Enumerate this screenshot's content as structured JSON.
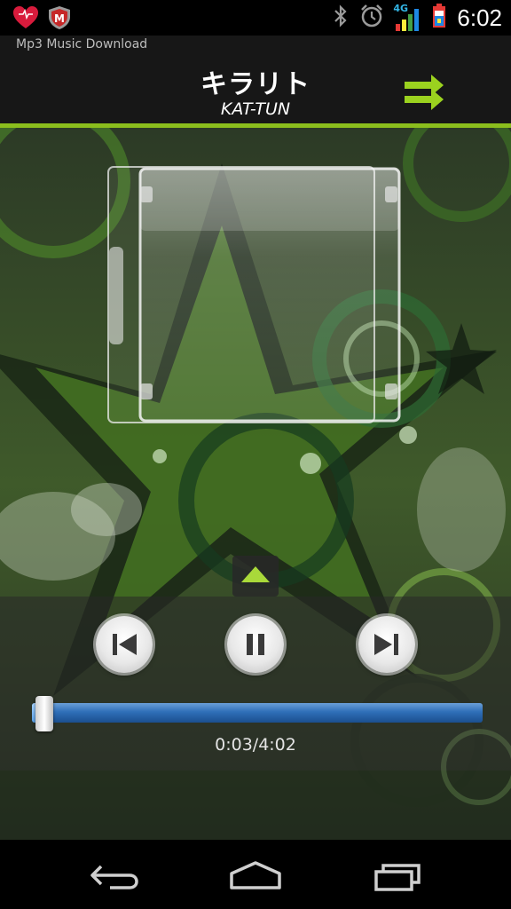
{
  "status_bar": {
    "time": "6:02",
    "icons": [
      "heart-app-icon",
      "mcafee-icon",
      "bluetooth-icon",
      "alarm-icon",
      "signal-4g-icon",
      "battery-icon"
    ],
    "network_label": "4G"
  },
  "app": {
    "name": "Mp3 Music Download"
  },
  "now_playing": {
    "title": "キラリト",
    "artist": "KAT-TUN"
  },
  "playback": {
    "time_display": "0:03/4:02",
    "progress": 0.0124
  },
  "controls": [
    "previous-button",
    "pause-button",
    "next-button"
  ],
  "colors": {
    "accent": "#8bbe1d",
    "seek_bar": "#2f6fb8"
  }
}
